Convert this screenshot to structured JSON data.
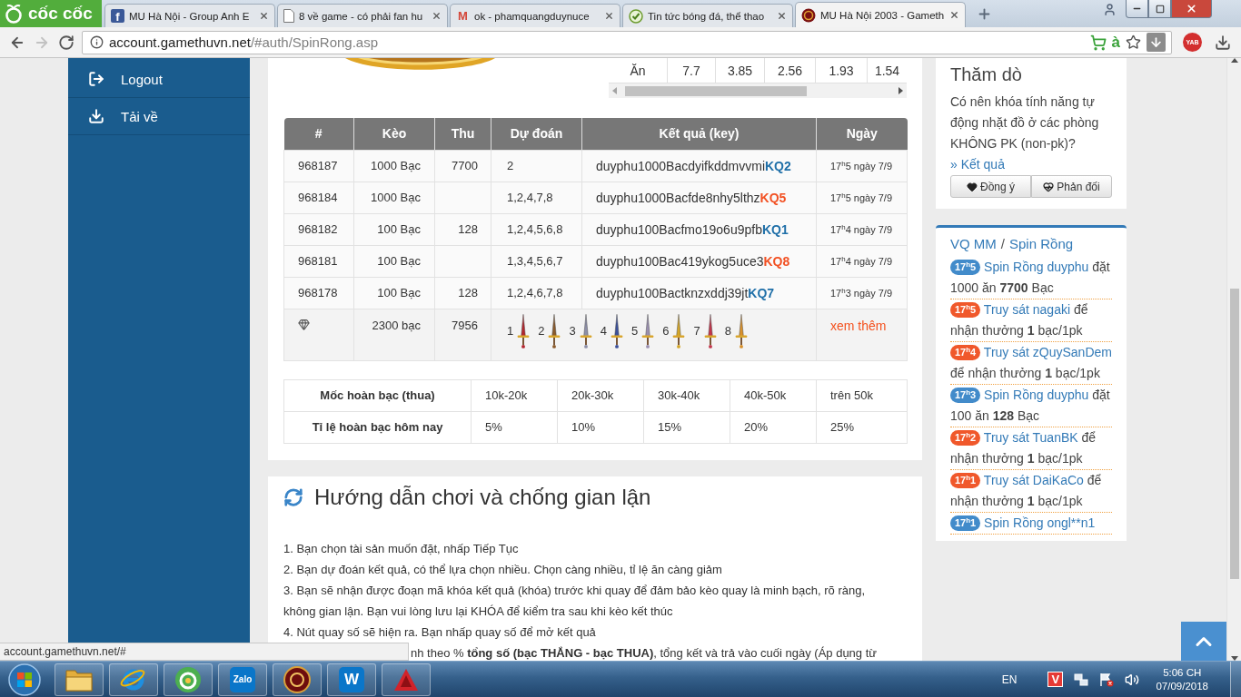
{
  "browser": {
    "menu_label": "cốc cốc",
    "tabs": [
      {
        "kind": "letter-tile",
        "letter": "f",
        "title": "MU Hà Nội - Group Anh E",
        "selected": false
      },
      {
        "kind": "page",
        "title": "8 về game - có phải fan hu",
        "selected": false
      },
      {
        "kind": "letter",
        "letter": "M",
        "title": "ok - phamquangduynuce",
        "selected": false
      },
      {
        "kind": "check",
        "title": "Tin tức bóng đá, thể thao",
        "selected": false
      },
      {
        "kind": "emblem",
        "title": "MU Hà Nội 2003 - Gameth",
        "selected": true
      }
    ],
    "nav": [
      {
        "kind": "back",
        "disabled": false
      },
      {
        "kind": "forward",
        "disabled": true
      },
      {
        "kind": "reload",
        "disabled": false
      }
    ],
    "address": {
      "host": "account.gamethuvn.net",
      "path": "/#auth/SpinRong.asp"
    },
    "address_glyph": "à",
    "extension_badge": "YAB"
  },
  "sidebar": {
    "items": [
      {
        "kind": "logout",
        "label": "Logout"
      },
      {
        "kind": "download",
        "label": "Tải về"
      }
    ]
  },
  "odds_table": {
    "label": "Ăn",
    "values": [
      "7.7",
      "3.85",
      "2.56",
      "1.93",
      "1.54"
    ]
  },
  "history": {
    "columns": [
      "#",
      "Kèo",
      "Thu",
      "Dự đoán",
      "Kết quả (key)",
      "Ngày"
    ],
    "rows": [
      {
        "id": "968187",
        "bet": "1000 Bạc",
        "thu": "7700",
        "prediction": "2",
        "key": "duyphu1000Bacdyifkddmvvmi",
        "result": "KQ2",
        "won": true,
        "date": "17$^{h}$5 ngày 7/9"
      },
      {
        "id": "968184",
        "bet": "1000 Bạc",
        "prediction": "1,2,4,7,8",
        "key": "duyphu1000Bacfde8nhy5lthz",
        "result": "KQ5",
        "won": false,
        "date": "17$^{h}$5 ngày 7/9"
      },
      {
        "id": "968182",
        "bet": "100 Bạc",
        "thu": "128",
        "prediction": "1,2,4,5,6,8",
        "key": "duyphu100Bacfmo19o6u9pfb",
        "result": "KQ1",
        "won": true,
        "date": "17$^{h}$4 ngày 7/9"
      },
      {
        "id": "968181",
        "bet": "100 Bạc",
        "prediction": "1,3,4,5,6,7",
        "key": "duyphu100Bac419ykog5uce3",
        "result": "KQ8",
        "won": false,
        "date": "17$^{h}$4 ngày 7/9"
      },
      {
        "id": "968178",
        "bet": "100 Bạc",
        "thu": "128",
        "prediction": "1,2,4,6,7,8",
        "key": "duyphu100Bactknzxddj39jt",
        "result": "KQ7",
        "won": true,
        "date": "17$^{h}$3 ngày 7/9"
      }
    ],
    "summary": {
      "total_bet": "2300 bạc",
      "total_thu": "7956",
      "items": [
        "1",
        "2",
        "3",
        "4",
        "5",
        "6",
        "7",
        "8"
      ],
      "more": "xem thêm"
    }
  },
  "refund_table": {
    "rows": [
      {
        "label": "Mốc hoàn bạc (thua)",
        "cells": [
          "10k-20k",
          "20k-30k",
          "30k-40k",
          "40k-50k",
          "trên 50k"
        ]
      },
      {
        "label": "Tỉ lệ hoàn bạc hôm nay",
        "cells": [
          "5%",
          "10%",
          "15%",
          "20%",
          "25%"
        ]
      }
    ]
  },
  "guide": {
    "title": "Hướng dẫn chơi và chống gian lận",
    "steps": [
      {
        "kind": "full",
        "text": "1. Bạn chọn tài sản muốn đặt, nhấp Tiếp Tục"
      },
      {
        "kind": "full",
        "text": "2. Bạn dự đoán kết quả, có thể lựa chọn nhiều. Chọn càng nhiều, tỉ lệ ăn càng giảm"
      },
      {
        "kind": "full",
        "text": "3. Bạn sẽ nhận được đoạn mã khóa kết quả (khóa) trước khi quay để đảm bảo kèo quay là minh bạch, rõ ràng, không gian lận. Bạn vui lòng lưu lại KHÓA để kiểm tra sau khi kèo kết thúc"
      },
      {
        "kind": "full",
        "text": "4. Nút quay số sẽ hiện ra. Bạn nhấp quay số để mở kết quả"
      },
      {
        "kind": "clipped",
        "text": "nh theo % **tổng số (bạc THẮNG - bạc THUA)**, tổng kết và trả vào cuối ngày (Áp dụng từ"
      }
    ]
  },
  "poll": {
    "title": "Thăm dò",
    "question": "Có nên khóa tính năng tự động nhặt đồ ở các phòng KHÔNG PK (non-pk)?",
    "result_link": "» Kết quả",
    "buttons": [
      {
        "kind": "heart",
        "label": "Đồng ý"
      },
      {
        "kind": "heartbeat",
        "label": "Phản đối"
      }
    ]
  },
  "feed": {
    "title_links": [
      "VQ MM",
      "Spin Rồng"
    ],
    "separator": "/",
    "items": [
      {
        "time": "17$^{h}$5",
        "color": "#428bca",
        "link": "Spin Rồng duyphu",
        "text": "đặt 1000 ăn **7700** Bạc"
      },
      {
        "time": "17$^{h}$5",
        "color": "#f0582b",
        "link": "Truy sát nagaki",
        "text": "để nhận thưởng **1** bạc/1pk"
      },
      {
        "time": "17$^{h}$4",
        "color": "#f0582b",
        "link": "Truy sát zQuySanDem",
        "text": "để nhận thưởng **1** bạc/1pk"
      },
      {
        "time": "17$^{h}$3",
        "color": "#428bca",
        "link": "Spin Rồng duyphu",
        "text": "đặt 100 ăn **128** Bạc"
      },
      {
        "time": "17$^{h}$2",
        "color": "#f0582b",
        "link": "Truy sát TuanBK",
        "text": "để nhận thưởng **1** bạc/1pk"
      },
      {
        "time": "17$^{h}$1",
        "color": "#f0582b",
        "link": "Truy sát DaiKaCo",
        "text": "để nhận thưởng **1** bạc/1pk"
      },
      {
        "time": "17$^{h}$1",
        "color": "#428bca",
        "link": "Spin Rồng ongl**n1"
      }
    ]
  },
  "status_url": "account.gamethuvn.net/#",
  "taskbar": {
    "apps": [
      {
        "kind": "folder"
      },
      {
        "kind": "ring"
      },
      {
        "kind": "round-logo"
      },
      {
        "kind": "tile",
        "label": "Zalo"
      },
      {
        "kind": "emblem"
      },
      {
        "kind": "tile",
        "label": "W"
      },
      {
        "kind": "triangle"
      }
    ],
    "language": "EN",
    "tray_tile": "V",
    "time": "5:06 CH",
    "date": "07/09/2018"
  }
}
